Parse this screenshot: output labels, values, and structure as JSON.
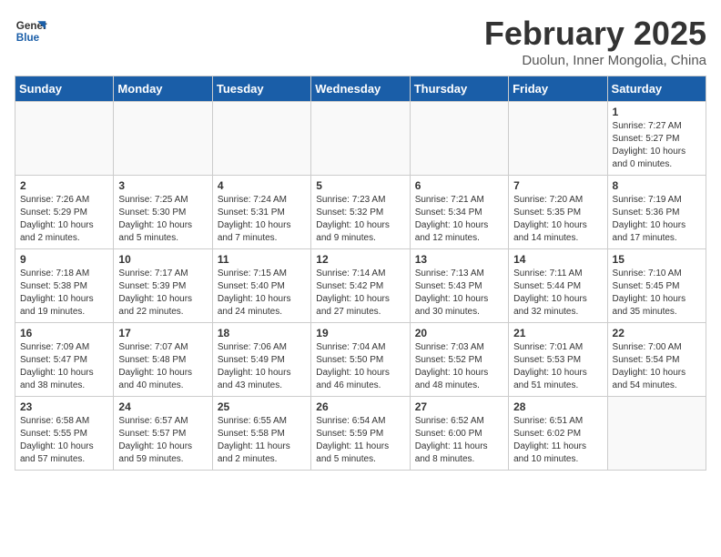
{
  "header": {
    "logo_general": "General",
    "logo_blue": "Blue",
    "month_title": "February 2025",
    "location": "Duolun, Inner Mongolia, China"
  },
  "weekdays": [
    "Sunday",
    "Monday",
    "Tuesday",
    "Wednesday",
    "Thursday",
    "Friday",
    "Saturday"
  ],
  "weeks": [
    [
      {
        "day": "",
        "info": ""
      },
      {
        "day": "",
        "info": ""
      },
      {
        "day": "",
        "info": ""
      },
      {
        "day": "",
        "info": ""
      },
      {
        "day": "",
        "info": ""
      },
      {
        "day": "",
        "info": ""
      },
      {
        "day": "1",
        "info": "Sunrise: 7:27 AM\nSunset: 5:27 PM\nDaylight: 10 hours\nand 0 minutes."
      }
    ],
    [
      {
        "day": "2",
        "info": "Sunrise: 7:26 AM\nSunset: 5:29 PM\nDaylight: 10 hours\nand 2 minutes."
      },
      {
        "day": "3",
        "info": "Sunrise: 7:25 AM\nSunset: 5:30 PM\nDaylight: 10 hours\nand 5 minutes."
      },
      {
        "day": "4",
        "info": "Sunrise: 7:24 AM\nSunset: 5:31 PM\nDaylight: 10 hours\nand 7 minutes."
      },
      {
        "day": "5",
        "info": "Sunrise: 7:23 AM\nSunset: 5:32 PM\nDaylight: 10 hours\nand 9 minutes."
      },
      {
        "day": "6",
        "info": "Sunrise: 7:21 AM\nSunset: 5:34 PM\nDaylight: 10 hours\nand 12 minutes."
      },
      {
        "day": "7",
        "info": "Sunrise: 7:20 AM\nSunset: 5:35 PM\nDaylight: 10 hours\nand 14 minutes."
      },
      {
        "day": "8",
        "info": "Sunrise: 7:19 AM\nSunset: 5:36 PM\nDaylight: 10 hours\nand 17 minutes."
      }
    ],
    [
      {
        "day": "9",
        "info": "Sunrise: 7:18 AM\nSunset: 5:38 PM\nDaylight: 10 hours\nand 19 minutes."
      },
      {
        "day": "10",
        "info": "Sunrise: 7:17 AM\nSunset: 5:39 PM\nDaylight: 10 hours\nand 22 minutes."
      },
      {
        "day": "11",
        "info": "Sunrise: 7:15 AM\nSunset: 5:40 PM\nDaylight: 10 hours\nand 24 minutes."
      },
      {
        "day": "12",
        "info": "Sunrise: 7:14 AM\nSunset: 5:42 PM\nDaylight: 10 hours\nand 27 minutes."
      },
      {
        "day": "13",
        "info": "Sunrise: 7:13 AM\nSunset: 5:43 PM\nDaylight: 10 hours\nand 30 minutes."
      },
      {
        "day": "14",
        "info": "Sunrise: 7:11 AM\nSunset: 5:44 PM\nDaylight: 10 hours\nand 32 minutes."
      },
      {
        "day": "15",
        "info": "Sunrise: 7:10 AM\nSunset: 5:45 PM\nDaylight: 10 hours\nand 35 minutes."
      }
    ],
    [
      {
        "day": "16",
        "info": "Sunrise: 7:09 AM\nSunset: 5:47 PM\nDaylight: 10 hours\nand 38 minutes."
      },
      {
        "day": "17",
        "info": "Sunrise: 7:07 AM\nSunset: 5:48 PM\nDaylight: 10 hours\nand 40 minutes."
      },
      {
        "day": "18",
        "info": "Sunrise: 7:06 AM\nSunset: 5:49 PM\nDaylight: 10 hours\nand 43 minutes."
      },
      {
        "day": "19",
        "info": "Sunrise: 7:04 AM\nSunset: 5:50 PM\nDaylight: 10 hours\nand 46 minutes."
      },
      {
        "day": "20",
        "info": "Sunrise: 7:03 AM\nSunset: 5:52 PM\nDaylight: 10 hours\nand 48 minutes."
      },
      {
        "day": "21",
        "info": "Sunrise: 7:01 AM\nSunset: 5:53 PM\nDaylight: 10 hours\nand 51 minutes."
      },
      {
        "day": "22",
        "info": "Sunrise: 7:00 AM\nSunset: 5:54 PM\nDaylight: 10 hours\nand 54 minutes."
      }
    ],
    [
      {
        "day": "23",
        "info": "Sunrise: 6:58 AM\nSunset: 5:55 PM\nDaylight: 10 hours\nand 57 minutes."
      },
      {
        "day": "24",
        "info": "Sunrise: 6:57 AM\nSunset: 5:57 PM\nDaylight: 10 hours\nand 59 minutes."
      },
      {
        "day": "25",
        "info": "Sunrise: 6:55 AM\nSunset: 5:58 PM\nDaylight: 11 hours\nand 2 minutes."
      },
      {
        "day": "26",
        "info": "Sunrise: 6:54 AM\nSunset: 5:59 PM\nDaylight: 11 hours\nand 5 minutes."
      },
      {
        "day": "27",
        "info": "Sunrise: 6:52 AM\nSunset: 6:00 PM\nDaylight: 11 hours\nand 8 minutes."
      },
      {
        "day": "28",
        "info": "Sunrise: 6:51 AM\nSunset: 6:02 PM\nDaylight: 11 hours\nand 10 minutes."
      },
      {
        "day": "",
        "info": ""
      }
    ]
  ]
}
